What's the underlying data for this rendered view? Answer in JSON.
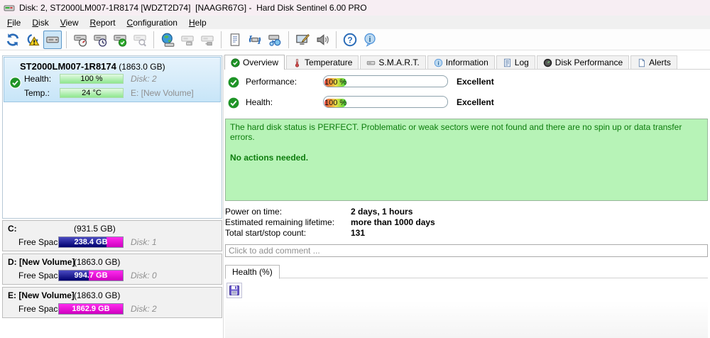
{
  "window": {
    "title": "Disk: 2, ST2000LM007-1R8174 [WDZT2D74]  [NAAGR67G] -  Hard Disk Sentinel 6.00 PRO"
  },
  "menu": {
    "items": {
      "file": "File",
      "disk": "Disk",
      "view": "View",
      "report": "Report",
      "configuration": "Configuration",
      "help": "Help"
    }
  },
  "toolbar": {
    "icons": [
      "refresh-icon",
      "disk-warning-icon",
      "disk-detect-icon",
      "disk-gauge-icon",
      "disk-clock-icon",
      "disk-check-icon",
      "disk-search-icon",
      "globe-disk-icon",
      "disk-cable-icon",
      "disk-plug-icon",
      "report-icon",
      "disk-sync-icon",
      "disk-network-icon",
      "monitor-pen-icon",
      "speaker-icon",
      "help-icon",
      "info-icon"
    ]
  },
  "sidebar": {
    "disk": {
      "model": "ST2000LM007-1R8174",
      "size": "(1863.0 GB)",
      "health_label": "Health:",
      "health_value": "100 %",
      "disk_no": "Disk: 2",
      "temp_label": "Temp.:",
      "temp_value": "24 °C",
      "volume": "E: [New Volume]"
    },
    "partitions": [
      {
        "name": "C:",
        "size": "(931.5 GB)",
        "free_label": "Free Space",
        "free_value": "238.4 GB",
        "disk_no": "Disk: 1",
        "used_pct": 74
      },
      {
        "name": "D: [New Volume]",
        "size": "(1863.0 GB)",
        "free_label": "Free Space",
        "free_value": "994.7 GB",
        "disk_no": "Disk: 0",
        "used_pct": 47
      },
      {
        "name": "E: [New Volume]",
        "size": "(1863.0 GB)",
        "free_label": "Free Space",
        "free_value": "1862.9 GB",
        "disk_no": "Disk: 2",
        "used_pct": 0
      }
    ]
  },
  "tabs": [
    {
      "label": "Overview",
      "icon": "check-circle-icon",
      "selected": true
    },
    {
      "label": "Temperature",
      "icon": "thermometer-icon",
      "selected": false
    },
    {
      "label": "S.M.A.R.T.",
      "icon": "disk-icon",
      "selected": false
    },
    {
      "label": "Information",
      "icon": "info-icon",
      "selected": false
    },
    {
      "label": "Log",
      "icon": "log-icon",
      "selected": false
    },
    {
      "label": "Disk Performance",
      "icon": "gauge-icon",
      "selected": false
    },
    {
      "label": "Alerts",
      "icon": "page-icon",
      "selected": false
    }
  ],
  "overview": {
    "performance": {
      "label": "Performance:",
      "value": "100 %",
      "rating": "Excellent",
      "pct": 100
    },
    "health": {
      "label": "Health:",
      "value": "100 %",
      "rating": "Excellent",
      "pct": 100
    },
    "status_text": "The hard disk status is PERFECT. Problematic or weak sectors were not found and there are no spin up or data transfer errors.",
    "status_action": "No actions needed.",
    "stats": [
      {
        "label": "Power on time:",
        "value": "2 days, 1 hours"
      },
      {
        "label": "Estimated remaining lifetime:",
        "value": "more than 1000 days"
      },
      {
        "label": "Total start/stop count:",
        "value": "131"
      }
    ],
    "comment_placeholder": "Click to add comment ...",
    "subtab": "Health (%)"
  },
  "colors": {
    "status_green_bg": "#b7f3b7",
    "status_green_text": "#0c7c0c",
    "free_bar_blue": "#00006e",
    "free_bar_magenta": "#dd00dd",
    "selected_disk_bg": "#c7e5f8"
  }
}
